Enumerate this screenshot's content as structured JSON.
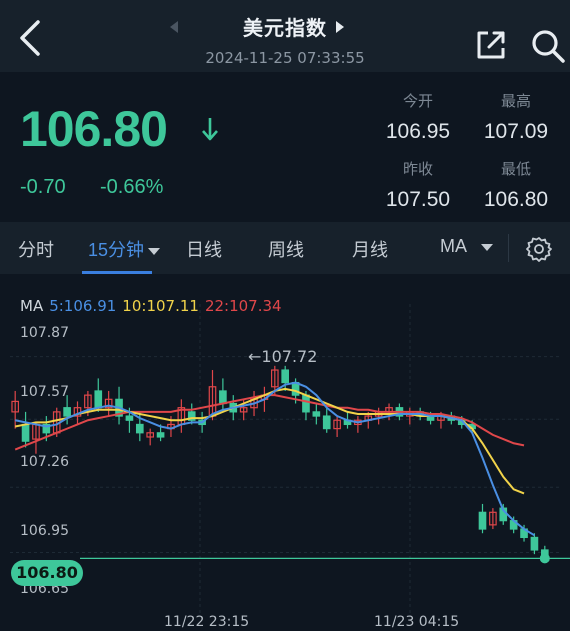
{
  "header": {
    "title": "美元指数",
    "datetime": "2024-11-25 07:33:55"
  },
  "quote": {
    "price": "106.80",
    "change": "-0.70",
    "change_pct": "-0.66%",
    "stats": {
      "open_label": "今开",
      "open": "106.95",
      "high_label": "最高",
      "high": "107.09",
      "prev_close_label": "昨收",
      "prev_close": "107.50",
      "low_label": "最低",
      "low": "106.80"
    }
  },
  "tabs": [
    {
      "label": "分时"
    },
    {
      "label": "15分钟"
    },
    {
      "label": "日线"
    },
    {
      "label": "周线"
    },
    {
      "label": "月线"
    },
    {
      "label": "MA"
    }
  ],
  "chart_data": {
    "type": "candlestick",
    "ma_legend": [
      {
        "label": "MA",
        "color": "#cfd6dc"
      },
      {
        "label": "5:106.91",
        "color": "#4a8fe3"
      },
      {
        "label": "10:107.11",
        "color": "#f1d34a"
      },
      {
        "label": "22:107.34",
        "color": "#e0474a"
      }
    ],
    "y_ticks": [
      "107.87",
      "107.57",
      "107.26",
      "106.95",
      "106.65"
    ],
    "x_ticks": [
      "11/22 23:15",
      "11/23 04:15"
    ],
    "annotation": "←107.72",
    "last_price_tag": "106.80",
    "ylim": [
      106.62,
      107.92
    ],
    "candles": [
      [
        107.5,
        107.6,
        107.42,
        107.55
      ],
      [
        107.44,
        107.5,
        107.33,
        107.36
      ],
      [
        107.37,
        107.45,
        107.3,
        107.44
      ],
      [
        107.44,
        107.48,
        107.36,
        107.4
      ],
      [
        107.4,
        107.52,
        107.38,
        107.5
      ],
      [
        107.52,
        107.58,
        107.44,
        107.48
      ],
      [
        107.48,
        107.55,
        107.44,
        107.52
      ],
      [
        107.52,
        107.6,
        107.48,
        107.58
      ],
      [
        107.6,
        107.66,
        107.5,
        107.52
      ],
      [
        107.52,
        107.6,
        107.48,
        107.56
      ],
      [
        107.56,
        107.62,
        107.44,
        107.48
      ],
      [
        107.48,
        107.52,
        107.4,
        107.46
      ],
      [
        107.44,
        107.5,
        107.36,
        107.4
      ],
      [
        107.38,
        107.42,
        107.34,
        107.4
      ],
      [
        107.4,
        107.44,
        107.36,
        107.38
      ],
      [
        107.42,
        107.48,
        107.38,
        107.44
      ],
      [
        107.44,
        107.56,
        107.4,
        107.52
      ],
      [
        107.5,
        107.54,
        107.44,
        107.46
      ],
      [
        107.46,
        107.5,
        107.4,
        107.44
      ],
      [
        107.48,
        107.7,
        107.46,
        107.62
      ],
      [
        107.6,
        107.66,
        107.5,
        107.54
      ],
      [
        107.54,
        107.58,
        107.46,
        107.5
      ],
      [
        107.5,
        107.56,
        107.46,
        107.52
      ],
      [
        107.52,
        107.6,
        107.48,
        107.56
      ],
      [
        107.56,
        107.62,
        107.5,
        107.58
      ],
      [
        107.62,
        107.72,
        107.58,
        107.7
      ],
      [
        107.7,
        107.72,
        107.6,
        107.64
      ],
      [
        107.64,
        107.66,
        107.54,
        107.58
      ],
      [
        107.58,
        107.6,
        107.46,
        107.5
      ],
      [
        107.5,
        107.54,
        107.44,
        107.48
      ],
      [
        107.48,
        107.52,
        107.4,
        107.42
      ],
      [
        107.42,
        107.48,
        107.38,
        107.46
      ],
      [
        107.46,
        107.5,
        107.42,
        107.44
      ],
      [
        107.44,
        107.48,
        107.4,
        107.46
      ],
      [
        107.46,
        107.5,
        107.42,
        107.48
      ],
      [
        107.48,
        107.52,
        107.44,
        107.5
      ],
      [
        107.5,
        107.54,
        107.46,
        107.52
      ],
      [
        107.52,
        107.54,
        107.46,
        107.48
      ],
      [
        107.48,
        107.52,
        107.44,
        107.5
      ],
      [
        107.5,
        107.52,
        107.46,
        107.48
      ],
      [
        107.48,
        107.5,
        107.44,
        107.46
      ],
      [
        107.46,
        107.5,
        107.42,
        107.48
      ],
      [
        107.48,
        107.5,
        107.44,
        107.46
      ],
      [
        107.46,
        107.48,
        107.42,
        107.44
      ],
      [
        107.44,
        107.46,
        107.4,
        107.42
      ],
      [
        107.02,
        107.06,
        106.92,
        106.94
      ],
      [
        106.96,
        107.04,
        106.94,
        107.02
      ],
      [
        107.04,
        107.06,
        106.96,
        106.98
      ],
      [
        106.98,
        107.0,
        106.92,
        106.94
      ],
      [
        106.94,
        106.96,
        106.88,
        106.9
      ],
      [
        106.9,
        106.92,
        106.82,
        106.84
      ],
      [
        106.84,
        106.86,
        106.8,
        106.8
      ]
    ],
    "ma5": [
      107.46,
      107.45,
      107.44,
      107.43,
      107.44,
      107.47,
      107.49,
      107.51,
      107.52,
      107.53,
      107.52,
      107.5,
      107.47,
      107.45,
      107.43,
      107.42,
      107.44,
      107.45,
      107.45,
      107.49,
      107.51,
      107.52,
      107.53,
      107.54,
      107.56,
      107.6,
      107.63,
      107.64,
      107.62,
      107.58,
      107.52,
      107.48,
      107.46,
      107.45,
      107.46,
      107.47,
      107.48,
      107.49,
      107.49,
      107.49,
      107.48,
      107.48,
      107.47,
      107.46,
      107.4,
      107.28,
      107.15,
      107.03,
      106.98,
      106.94,
      106.91
    ],
    "ma10": [
      107.43,
      107.44,
      107.45,
      107.45,
      107.46,
      107.47,
      107.49,
      107.5,
      107.51,
      107.51,
      107.51,
      107.5,
      107.49,
      107.48,
      107.47,
      107.46,
      107.46,
      107.47,
      107.47,
      107.48,
      107.5,
      107.52,
      107.54,
      107.56,
      107.58,
      107.6,
      107.61,
      107.6,
      107.58,
      107.56,
      107.54,
      107.52,
      107.5,
      107.49,
      107.49,
      107.49,
      107.49,
      107.49,
      107.49,
      107.48,
      107.48,
      107.48,
      107.47,
      107.46,
      107.42,
      107.35,
      107.27,
      107.19,
      107.13,
      107.11
    ],
    "ma22": [
      107.32,
      107.34,
      107.36,
      107.38,
      107.4,
      107.42,
      107.44,
      107.46,
      107.47,
      107.48,
      107.49,
      107.5,
      107.5,
      107.5,
      107.5,
      107.5,
      107.51,
      107.51,
      107.52,
      107.53,
      107.54,
      107.55,
      107.56,
      107.57,
      107.58,
      107.58,
      107.57,
      107.56,
      107.55,
      107.54,
      107.53,
      107.52,
      107.52,
      107.51,
      107.51,
      107.5,
      107.5,
      107.5,
      107.5,
      107.5,
      107.49,
      107.49,
      107.48,
      107.47,
      107.45,
      107.42,
      107.39,
      107.37,
      107.35,
      107.34
    ]
  }
}
